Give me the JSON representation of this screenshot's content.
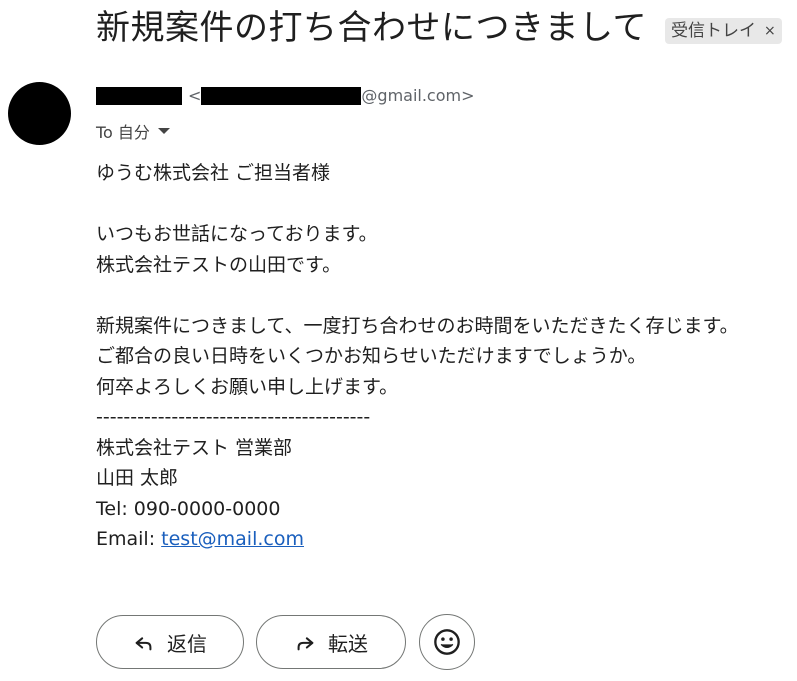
{
  "subject": "新規案件の打ち合わせにつきまして",
  "label": {
    "text": "受信トレイ",
    "remove": "×"
  },
  "sender": {
    "email_suffix": "@gmail.com>",
    "email_prefix": "<"
  },
  "recipient": {
    "text": "To 自分"
  },
  "body_lines": [
    "ゆうむ株式会社 ご担当者様",
    "",
    "いつもお世話になっております。",
    "株式会社テストの山田です。",
    "",
    "新規案件につきまして、一度打ち合わせのお時間をいただきたく存じます。",
    "ご都合の良い日時をいくつかお知らせいただけますでしょうか。",
    "何卒よろしくお願い申し上げます。",
    "----------------------------------------",
    "株式会社テスト 営業部",
    "山田 太郎",
    "Tel: 090-0000-0000"
  ],
  "email_line": {
    "prefix": "Email: ",
    "link": "test@mail.com"
  },
  "actions": {
    "reply": "返信",
    "forward": "転送"
  }
}
